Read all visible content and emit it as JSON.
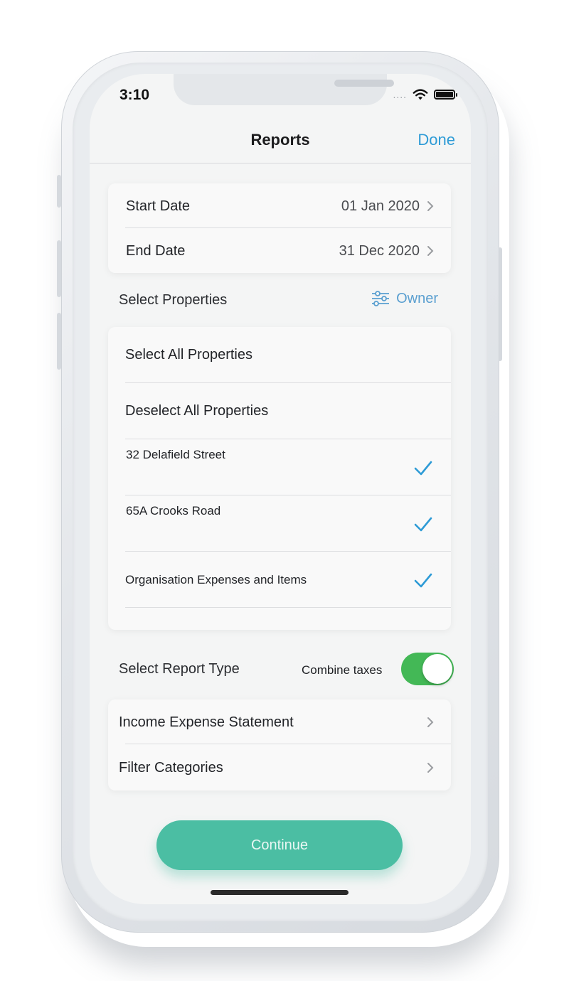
{
  "status_bar": {
    "time": "3:10",
    "dots": "....",
    "wifi_icon": "wifi-icon",
    "battery_icon": "battery-icon"
  },
  "nav": {
    "title": "Reports",
    "done_label": "Done"
  },
  "date_range": {
    "start_label": "Start Date",
    "start_value": "01 Jan 2020",
    "end_label": "End Date",
    "end_value": "31 Dec 2020"
  },
  "properties_section": {
    "label": "Select Properties",
    "owner_label": "Owner",
    "select_all": "Select All Properties",
    "deselect_all": "Deselect All Properties",
    "items": [
      {
        "name": "32 Delafield Street",
        "checked": true
      },
      {
        "name": "65A Crooks Road",
        "checked": true
      },
      {
        "name": "Organisation Expenses and Items",
        "checked": true
      }
    ]
  },
  "report_type_section": {
    "label": "Select Report Type",
    "combine_taxes_label": "Combine taxes",
    "combine_taxes_on": true,
    "report_type": "Income Expense Statement",
    "filter_label": "Filter Categories"
  },
  "continue_label": "Continue",
  "colors": {
    "accent": "#2e9bd6",
    "toggle_on": "#43b856",
    "continue_bg": "#4bbea3"
  }
}
